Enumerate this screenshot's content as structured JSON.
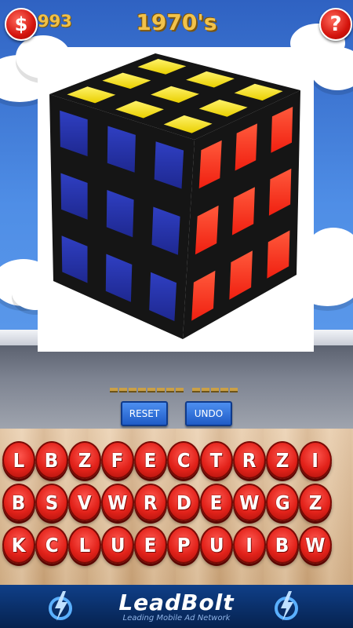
{
  "header": {
    "coin_symbol": "$",
    "coins": "993",
    "level_title": "1970's",
    "help_symbol": "?"
  },
  "answer": {
    "word_lengths": [
      8,
      5
    ]
  },
  "buttons": {
    "reset": "RESET",
    "undo": "UNDO"
  },
  "letters": [
    [
      "L",
      "B",
      "Z",
      "F",
      "E",
      "C",
      "T",
      "R",
      "Z",
      "I"
    ],
    [
      "B",
      "S",
      "V",
      "W",
      "R",
      "D",
      "E",
      "W",
      "G",
      "Z"
    ],
    [
      "K",
      "C",
      "L",
      "U",
      "E",
      "P",
      "U",
      "I",
      "B",
      "W"
    ]
  ],
  "ad": {
    "logo": "LeadBolt",
    "tagline": "Leading Mobile Ad Network"
  },
  "colors": {
    "tile_red": "#e2221a",
    "title_gold": "#f2c24a",
    "button_blue": "#2a6ad6",
    "ad_navy": "#0a2f6a",
    "cube_yellow": "#f3e21c",
    "cube_red": "#f43a1f",
    "cube_blue": "#2a37b0"
  },
  "icons": {
    "coin": "coin-icon",
    "help": "help-icon",
    "ad_left": "leadbolt-bolt-icon",
    "ad_right": "leadbolt-bolt-icon"
  }
}
